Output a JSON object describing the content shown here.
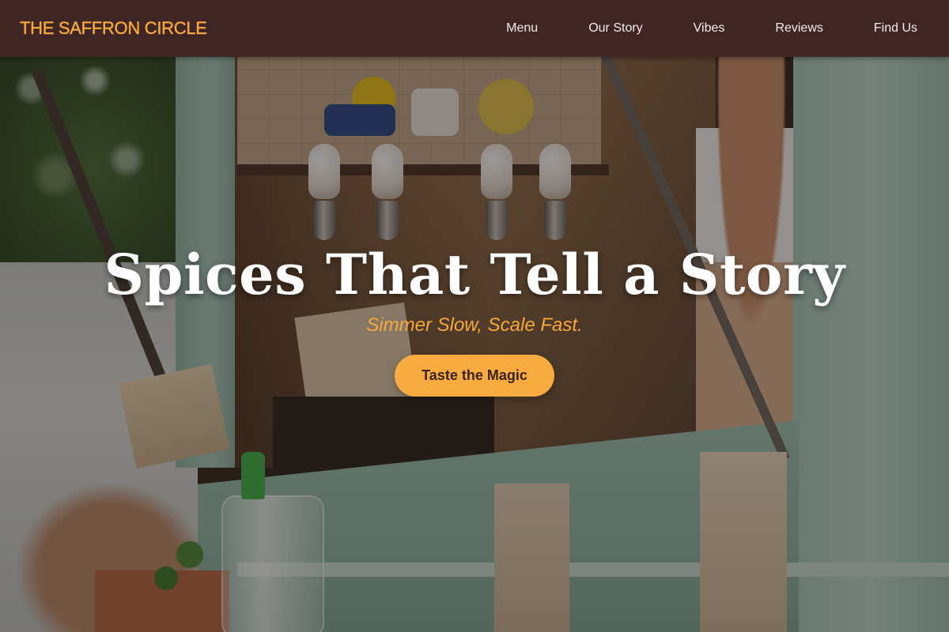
{
  "header": {
    "logo": "THE SAFFRON CIRCLE",
    "nav": [
      {
        "label": "Menu"
      },
      {
        "label": "Our Story"
      },
      {
        "label": "Vibes"
      },
      {
        "label": "Reviews"
      },
      {
        "label": "Find Us"
      }
    ]
  },
  "hero": {
    "title": "Spices That Tell a Story",
    "tagline": "Simmer Slow, Scale Fast.",
    "cta_label": "Taste the Magic",
    "background_photo": "food-truck-counter-photo"
  },
  "colors": {
    "header_bg": "#3f2523",
    "accent": "#f6a83c",
    "cta_bg": "#f8ac40",
    "nav_text": "#f3ece9",
    "title_text": "#ffffff"
  }
}
